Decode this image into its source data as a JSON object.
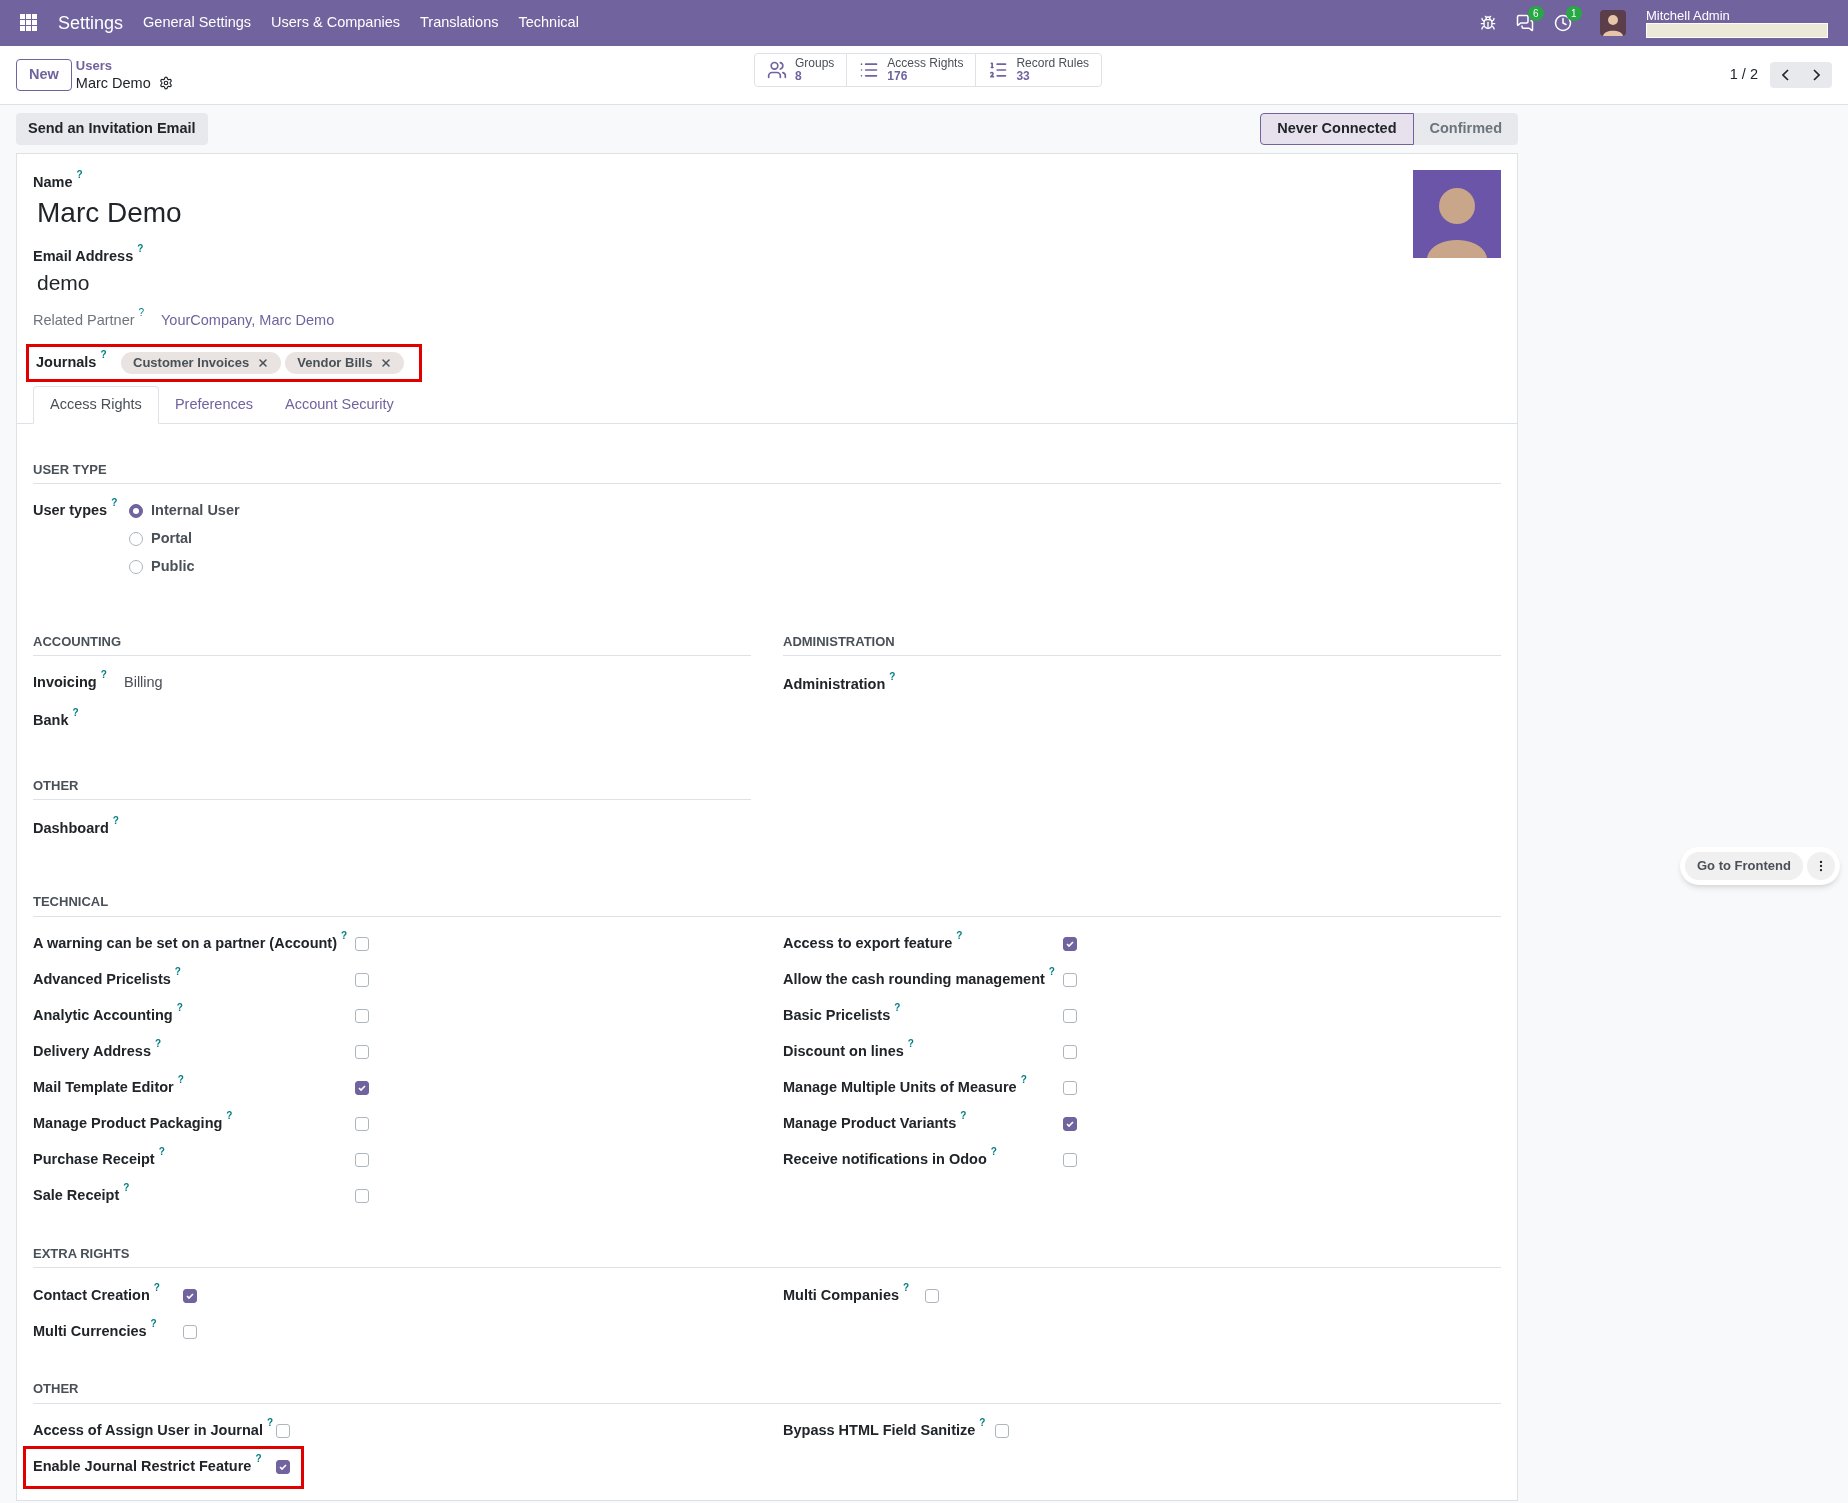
{
  "navbar": {
    "app": "Settings",
    "menu": [
      "General Settings",
      "Users & Companies",
      "Translations",
      "Technical"
    ],
    "chat_count": "6",
    "activity_count": "1",
    "user": "Mitchell Admin"
  },
  "control_panel": {
    "new": "New",
    "breadcrumb_parent": "Users",
    "breadcrumb_current": "Marc Demo",
    "stats": [
      {
        "label": "Groups",
        "value": "8",
        "kind": "users"
      },
      {
        "label": "Access Rights",
        "value": "176",
        "kind": "list"
      },
      {
        "label": "Record Rules",
        "value": "33",
        "kind": "bullets"
      }
    ],
    "pager": "1 / 2"
  },
  "action": "Send an Invitation Email",
  "statusbar": [
    {
      "label": "Never Connected",
      "selected": true
    },
    {
      "label": "Confirmed",
      "selected": false
    }
  ],
  "form": {
    "name_label": {
      "text": "Name",
      "help": "?"
    },
    "name": "Marc Demo",
    "email_label": {
      "text": "Email Address",
      "help": "?"
    },
    "email": "demo",
    "partner_label": {
      "text": "Related Partner",
      "help": "?"
    },
    "partner": "YourCompany, Marc Demo",
    "journals_label": {
      "text": "Journals",
      "help": "?"
    },
    "journals_highlighted": true,
    "journals": [
      "Customer Invoices",
      "Vendor Bills"
    ]
  },
  "tabs": [
    {
      "label": "Access Rights",
      "selected": true
    },
    {
      "label": "Preferences",
      "selected": false
    },
    {
      "label": "Account Security",
      "selected": false
    }
  ],
  "user_type": {
    "title": "USER TYPE",
    "label": {
      "text": "User types",
      "help": "?"
    },
    "options": [
      {
        "label": "Internal User",
        "selected": true
      },
      {
        "label": "Portal",
        "selected": false
      },
      {
        "label": "Public",
        "selected": false
      }
    ]
  },
  "accounting": {
    "title": "ACCOUNTING",
    "fields": [
      {
        "text": "Invoicing",
        "help": "?",
        "value": "Billing"
      },
      {
        "text": "Bank",
        "help": "?"
      }
    ]
  },
  "administration": {
    "title": "ADMINISTRATION",
    "fields": [
      {
        "text": "Administration",
        "help": "?"
      }
    ]
  },
  "other_apps": {
    "title": "OTHER",
    "fields": [
      {
        "text": "Dashboard",
        "help": "?"
      }
    ]
  },
  "check_sections": [
    {
      "title": "TECHNICAL",
      "left": [
        {
          "text": "A warning can be set on a partner (Account)",
          "help": "?",
          "checked": false
        },
        {
          "text": "Advanced Pricelists",
          "help": "?",
          "checked": false
        },
        {
          "text": "Analytic Accounting",
          "help": "?",
          "checked": false
        },
        {
          "text": "Delivery Address",
          "help": "?",
          "checked": false
        },
        {
          "text": "Mail Template Editor",
          "help": "?",
          "checked": true
        },
        {
          "text": "Manage Product Packaging",
          "help": "?",
          "checked": false
        },
        {
          "text": "Purchase Receipt",
          "help": "?",
          "checked": false
        },
        {
          "text": "Sale Receipt",
          "help": "?",
          "checked": false
        }
      ],
      "right": [
        {
          "text": "Access to export feature",
          "help": "?",
          "checked": true
        },
        {
          "text": "Allow the cash rounding management",
          "help": "?",
          "checked": false
        },
        {
          "text": "Basic Pricelists",
          "help": "?",
          "checked": false
        },
        {
          "text": "Discount on lines",
          "help": "?",
          "checked": false
        },
        {
          "text": "Manage Multiple Units of Measure",
          "help": "?",
          "checked": false
        },
        {
          "text": "Manage Product Variants",
          "help": "?",
          "checked": true
        },
        {
          "text": "Receive notifications in Odoo",
          "help": "?",
          "checked": false
        }
      ]
    },
    {
      "title": "EXTRA RIGHTS",
      "left": [
        {
          "text": "Contact Creation",
          "help": "?",
          "checked": true
        },
        {
          "text": "Multi Currencies",
          "help": "?",
          "checked": false
        }
      ],
      "right": [
        {
          "text": "Multi Companies",
          "help": "?",
          "checked": false
        }
      ]
    },
    {
      "title": "OTHER",
      "left": [
        {
          "text": "Access of Assign User in Journal",
          "help": "?",
          "checked": false
        },
        {
          "text": "Enable Journal Restrict Feature",
          "help": "?",
          "checked": true,
          "highlighted": true
        }
      ],
      "right": [
        {
          "text": "Bypass HTML Field Sanitize",
          "help": "?",
          "checked": false
        }
      ]
    }
  ],
  "frontend_button": "Go to Frontend"
}
